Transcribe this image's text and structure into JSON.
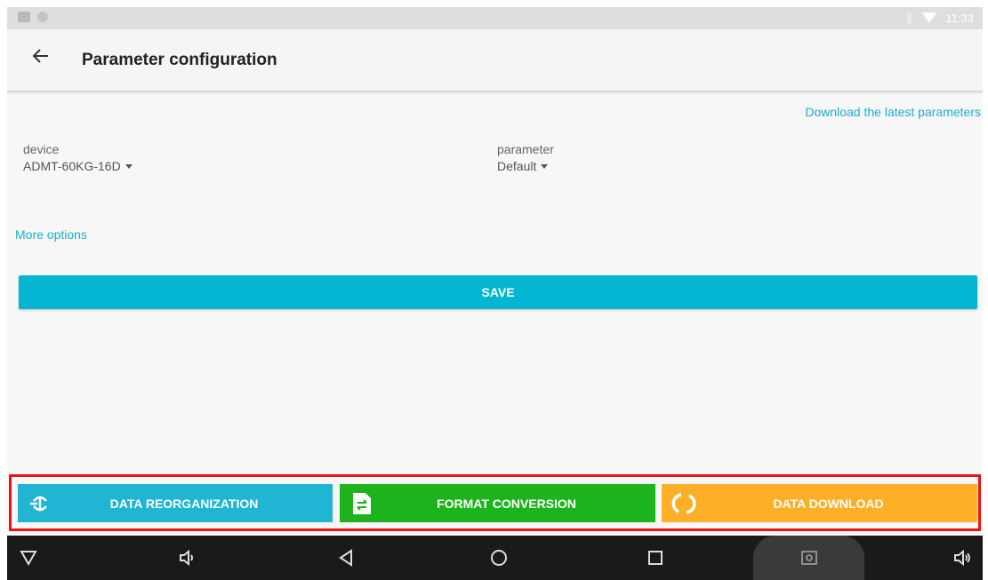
{
  "status_bar": {
    "time": "11:33",
    "icons": [
      "image-icon",
      "circle-icon",
      "bluetooth-icon",
      "wifi-icon"
    ]
  },
  "app_bar": {
    "title": "Parameter configuration",
    "back_icon": "arrow-left-icon"
  },
  "content": {
    "download_link": "Download the latest parameters",
    "device": {
      "label": "device",
      "value": "ADMT-60KG-16D"
    },
    "parameter": {
      "label": "parameter",
      "value": "Default"
    },
    "more_options": "More options",
    "save_label": "SAVE"
  },
  "bottom_buttons": [
    {
      "label": "DATA REORGANIZATION",
      "icon": "reorganize-icon",
      "color": "#1fb5d3"
    },
    {
      "label": "FORMAT CONVERSION",
      "icon": "file-convert-icon",
      "color": "#1db31c"
    },
    {
      "label": "DATA DOWNLOAD",
      "icon": "refresh-icon",
      "color": "#fdb027"
    }
  ],
  "nav_bar": {
    "icons": [
      "down-triangle-icon",
      "volume-down-icon",
      "back-icon",
      "home-icon",
      "recents-icon",
      "screenshot-icon",
      "volume-up-icon"
    ]
  },
  "colors": {
    "accent": "#04b6d1",
    "highlight_border": "#ee1111"
  }
}
